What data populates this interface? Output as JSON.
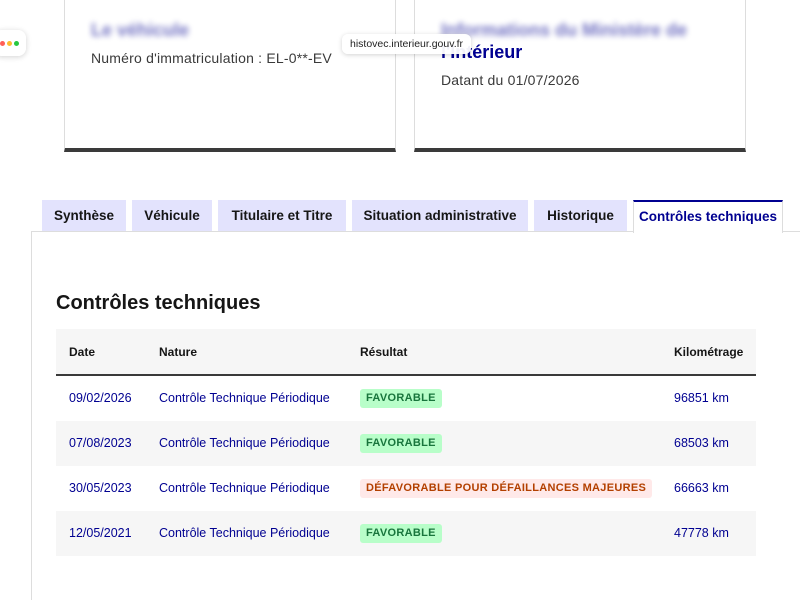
{
  "cards": {
    "left": {
      "title": "Le véhicule",
      "text": "Numéro d'immatriculation : EL-0**-EV"
    },
    "right": {
      "title_line1": "Informations du Ministère de",
      "title_line2": "l'Intérieur",
      "text": "Datant du 01/07/2026"
    }
  },
  "browser": {
    "url": "histovec.interieur.gouv.fr"
  },
  "tabs": [
    {
      "label": "Synthèse"
    },
    {
      "label": "Véhicule"
    },
    {
      "label": "Titulaire et Titre"
    },
    {
      "label": "Situation administrative"
    },
    {
      "label": "Historique"
    },
    {
      "label": "Contrôles techniques",
      "active": true
    }
  ],
  "section": {
    "title": "Contrôles techniques",
    "columns": [
      "Date",
      "Nature",
      "Résultat",
      "Kilométrage"
    ],
    "rows": [
      {
        "date": "09/02/2026",
        "nature": "Contrôle Technique Périodique",
        "result": "FAVORABLE",
        "status": "ok",
        "km": "96851 km"
      },
      {
        "date": "07/08/2023",
        "nature": "Contrôle Technique Périodique",
        "result": "FAVORABLE",
        "status": "ok",
        "km": "68503 km"
      },
      {
        "date": "30/05/2023",
        "nature": "Contrôle Technique Périodique",
        "result": "DÉFAVORABLE POUR DÉFAILLANCES MAJEURES",
        "status": "ko",
        "km": "66663 km"
      },
      {
        "date": "12/05/2021",
        "nature": "Contrôle Technique Périodique",
        "result": "FAVORABLE",
        "status": "ok",
        "km": "47778 km"
      }
    ]
  },
  "colors": {
    "primary": "#000091",
    "tab_bg": "#e3e3fd",
    "ok_bg": "#b8fec9",
    "ok_fg": "#18753c",
    "ko_bg": "#ffe9e9",
    "ko_fg": "#b34000"
  }
}
